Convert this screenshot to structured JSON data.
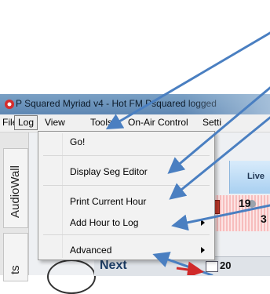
{
  "window": {
    "title": "P Squared Myriad v4 - Hot FM Psquared logged"
  },
  "menubar": {
    "items": [
      {
        "label": "File"
      },
      {
        "label": "Log"
      },
      {
        "label": "View"
      },
      {
        "label": "Tools"
      },
      {
        "label": "On-Air Control"
      },
      {
        "label": "Setti"
      }
    ]
  },
  "log_menu": {
    "items": [
      {
        "label": "Go!"
      },
      {
        "label": "Display Seg Editor"
      },
      {
        "label": "Print Current Hour"
      },
      {
        "label": "Add Hour to Log"
      },
      {
        "label": "Advanced"
      }
    ]
  },
  "left_tabs": [
    {
      "label": "AudioWall"
    },
    {
      "label": "ts"
    }
  ],
  "background": {
    "live_label": "Live",
    "cart_line1": "19",
    "cart_line2": "3",
    "next_label": "Next",
    "next_time": "20"
  },
  "colors": {
    "titlebar": "#5e87b3",
    "menu_bg": "#f2f2f2",
    "annotation_arrow": "#4a7fc1",
    "cart_bg": "#fce4e4"
  }
}
